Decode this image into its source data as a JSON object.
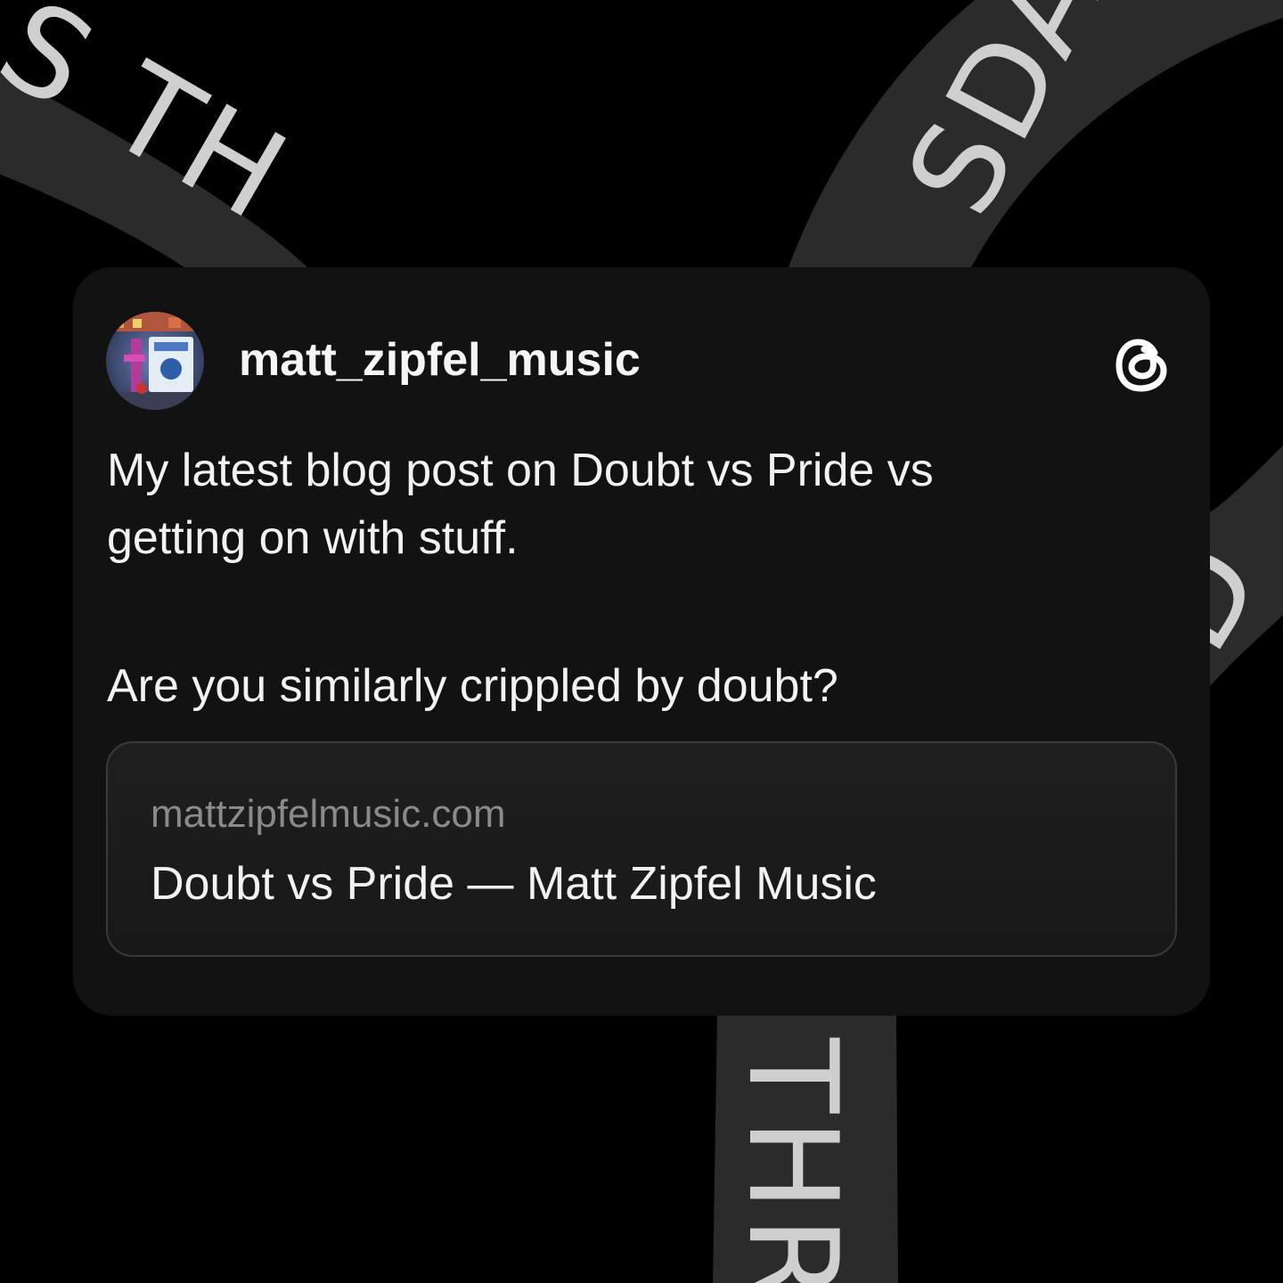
{
  "background": {
    "ribbon_color": "#2b2b2b",
    "ribbon_text_color": "#cfcfcf",
    "ribbon_top_left_text": "S TH",
    "ribbon_top_right_text": "SDA",
    "ribbon_right_text": "D",
    "ribbon_bottom_text": "THR"
  },
  "post": {
    "username": "matt_zipfel_music",
    "avatar_icon": "profile-photo-avatar",
    "brand_icon": "threads-logo-icon",
    "paragraphs": [
      "My latest blog post on Doubt vs Pride vs\ngetting on with stuff.",
      "Are you similarly crippled by doubt?"
    ],
    "link_preview": {
      "domain": "mattzipfelmusic.com",
      "title": "Doubt vs Pride — Matt Zipfel Music"
    }
  },
  "colors": {
    "page_background": "#000000",
    "card_background": "#121212",
    "text_primary": "#f2f2f2",
    "text_secondary": "#8a8a8a",
    "link_border": "#3a3a3a"
  }
}
